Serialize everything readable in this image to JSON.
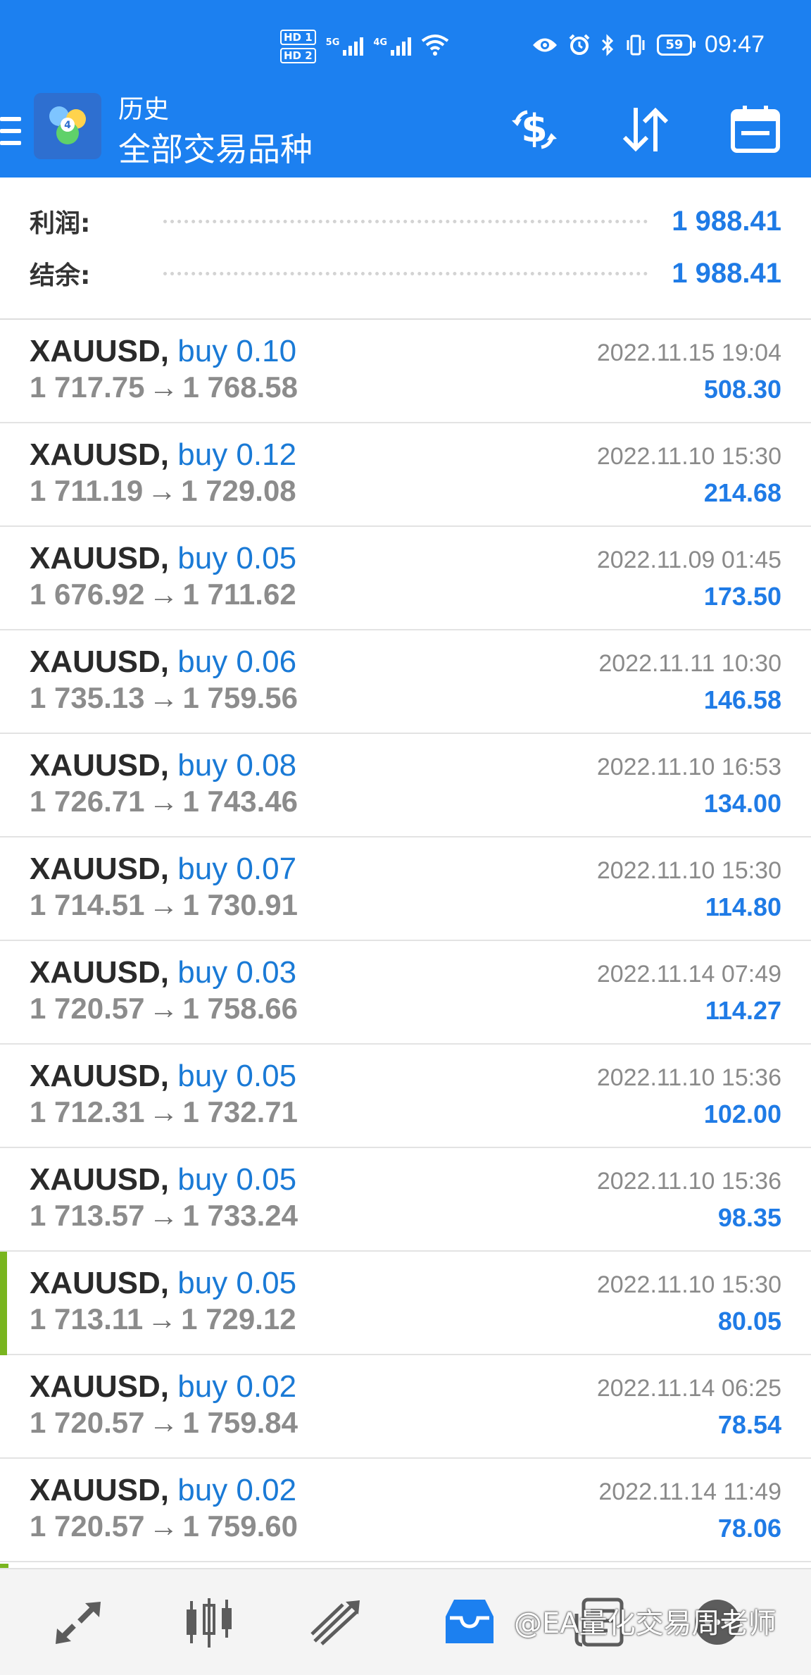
{
  "status_bar": {
    "sim1": "HD 1",
    "sim2": "HD 2",
    "net1": "5G",
    "net2": "4G",
    "battery": "59",
    "time": "09:47",
    "icons": [
      "eye-icon",
      "alarm-icon",
      "bluetooth-icon",
      "vibrate-icon",
      "wifi-icon"
    ]
  },
  "app_bar": {
    "title": "历史",
    "subtitle": "全部交易品种",
    "actions": [
      "currency-exchange-icon",
      "sort-icon",
      "calendar-icon"
    ],
    "accent_color": "#1c80f0"
  },
  "summary": {
    "profit_label": "利润:",
    "profit_value": "1 988.41",
    "balance_label": "结余:",
    "balance_value": "1 988.41"
  },
  "trades": [
    {
      "symbol": "XAUUSD,",
      "side": "buy 0.10",
      "open": "1 717.75",
      "close": "1 768.58",
      "date": "2022.11.15 19:04",
      "profit": "508.30"
    },
    {
      "symbol": "XAUUSD,",
      "side": "buy 0.12",
      "open": "1 711.19",
      "close": "1 729.08",
      "date": "2022.11.10 15:30",
      "profit": "214.68"
    },
    {
      "symbol": "XAUUSD,",
      "side": "buy 0.05",
      "open": "1 676.92",
      "close": "1 711.62",
      "date": "2022.11.09 01:45",
      "profit": "173.50"
    },
    {
      "symbol": "XAUUSD,",
      "side": "buy 0.06",
      "open": "1 735.13",
      "close": "1 759.56",
      "date": "2022.11.11 10:30",
      "profit": "146.58"
    },
    {
      "symbol": "XAUUSD,",
      "side": "buy 0.08",
      "open": "1 726.71",
      "close": "1 743.46",
      "date": "2022.11.10 16:53",
      "profit": "134.00"
    },
    {
      "symbol": "XAUUSD,",
      "side": "buy 0.07",
      "open": "1 714.51",
      "close": "1 730.91",
      "date": "2022.11.10 15:30",
      "profit": "114.80"
    },
    {
      "symbol": "XAUUSD,",
      "side": "buy 0.03",
      "open": "1 720.57",
      "close": "1 758.66",
      "date": "2022.11.14 07:49",
      "profit": "114.27"
    },
    {
      "symbol": "XAUUSD,",
      "side": "buy 0.05",
      "open": "1 712.31",
      "close": "1 732.71",
      "date": "2022.11.10 15:36",
      "profit": "102.00"
    },
    {
      "symbol": "XAUUSD,",
      "side": "buy 0.05",
      "open": "1 713.57",
      "close": "1 733.24",
      "date": "2022.11.10 15:36",
      "profit": "98.35"
    },
    {
      "symbol": "XAUUSD,",
      "side": "buy 0.05",
      "open": "1 713.11",
      "close": "1 729.12",
      "date": "2022.11.10 15:30",
      "profit": "80.05"
    },
    {
      "symbol": "XAUUSD,",
      "side": "buy 0.02",
      "open": "1 720.57",
      "close": "1 759.84",
      "date": "2022.11.14 06:25",
      "profit": "78.54"
    },
    {
      "symbol": "XAUUSD,",
      "side": "buy 0.02",
      "open": "1 720.57",
      "close": "1 759.60",
      "date": "2022.11.14 11:49",
      "profit": "78.06"
    }
  ],
  "arrow_glyph": "→",
  "bottom_nav": {
    "items": [
      "quotes-icon",
      "chart-icon",
      "trade-icon",
      "history-icon",
      "news-icon",
      "chat-icon"
    ],
    "active": "history-icon",
    "watermark": "@EA量化交易周老师"
  }
}
